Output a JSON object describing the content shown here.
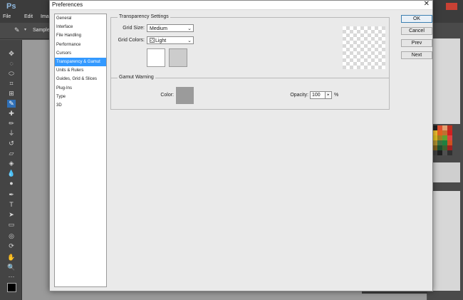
{
  "background_app": {
    "logo": "Ps",
    "menus": [
      "File",
      "Edit",
      "Ima"
    ],
    "options_label": "Sample"
  },
  "dialog": {
    "title": "Preferences",
    "close_glyph": "✕",
    "nav_items": [
      "General",
      "Interface",
      "File Handling",
      "Performance",
      "Cursors",
      "Transparency & Gamut",
      "Units & Rulers",
      "Guides, Grid & Slices",
      "Plug-Ins",
      "Type",
      "3D"
    ],
    "active_nav_index": 5,
    "transparency": {
      "group_title": "Transparency Settings",
      "grid_size_label": "Grid Size:",
      "grid_size_value": "Medium",
      "grid_colors_label": "Grid Colors:",
      "grid_colors_value": "Light",
      "swatch_1_color": "#ffffff",
      "swatch_2_color": "#cccccc"
    },
    "gamut": {
      "group_title": "Gamut Warning",
      "color_label": "Color:",
      "color_value": "#9b9b9b",
      "opacity_label": "Opacity:",
      "opacity_value": "100",
      "opacity_unit": "%"
    },
    "buttons": {
      "ok": "OK",
      "cancel": "Cancel",
      "prev": "Prev",
      "next": "Next"
    }
  }
}
